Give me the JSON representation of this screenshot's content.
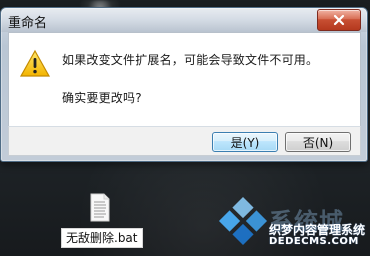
{
  "dialog": {
    "title": "重命名",
    "message": "如果改变文件扩展名，可能会导致文件不可用。",
    "confirm": "确实要更改吗?",
    "buttons": {
      "yes": "是(Y)",
      "no": "否(N)"
    },
    "icons": {
      "warning": "warning-icon",
      "close": "close-icon"
    }
  },
  "desktop": {
    "file": {
      "name": "无敌删除.bat",
      "icon": "batch-file-icon"
    }
  },
  "watermark": {
    "brand": "系统城",
    "text": "织梦内容管理系统",
    "url": "DEDECMS.COM",
    "logo": "windows-logo-icon"
  },
  "colors": {
    "titlebar": "#c2ccd8",
    "close_button": "#c84f33",
    "dialog_body": "#ffffff",
    "footer": "#f1f1f1",
    "desktop": "#1f2327",
    "default_button": "#bee6fd",
    "watermark_blue": "#4f7db5"
  }
}
